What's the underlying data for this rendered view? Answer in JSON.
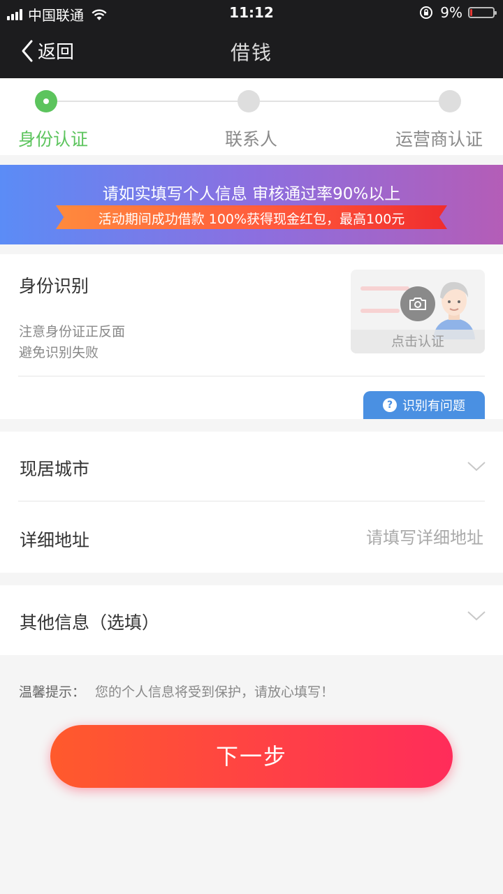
{
  "status_bar": {
    "carrier": "中国联通",
    "time": "11:12",
    "battery_text": "9%",
    "battery_level": 0.09,
    "battery_color": "#e53935"
  },
  "nav": {
    "back_label": "返回",
    "title": "借钱"
  },
  "steps": [
    {
      "label": "身份认证",
      "active": true
    },
    {
      "label": "联系人",
      "active": false
    },
    {
      "label": "运营商认证",
      "active": false
    }
  ],
  "banner": {
    "line1": "请如实填写个人信息 审核通过率90%以上",
    "line2": "活动期间成功借款 100%获得现金红包，最高100元"
  },
  "id_section": {
    "title": "身份识别",
    "tip1": "注意身份证正反面",
    "tip2": "避免识别失败",
    "card_label": "点击认证",
    "problem_label": "识别有问题"
  },
  "address": {
    "city_label": "现居城市",
    "detail_label": "详细地址",
    "detail_placeholder": "请填写详细地址",
    "detail_value": ""
  },
  "other": {
    "label": "其他信息（选填）"
  },
  "tip": {
    "prefix": "温馨提示：",
    "text": "您的个人信息将受到保护，请放心填写！"
  },
  "next_button": "下一步",
  "colors": {
    "accent_green": "#5cc45d",
    "nav_bg": "#1c1c1e",
    "info_blue": "#4a90e2",
    "cta_start": "#ff5a2c",
    "cta_end": "#ff2c5a"
  }
}
